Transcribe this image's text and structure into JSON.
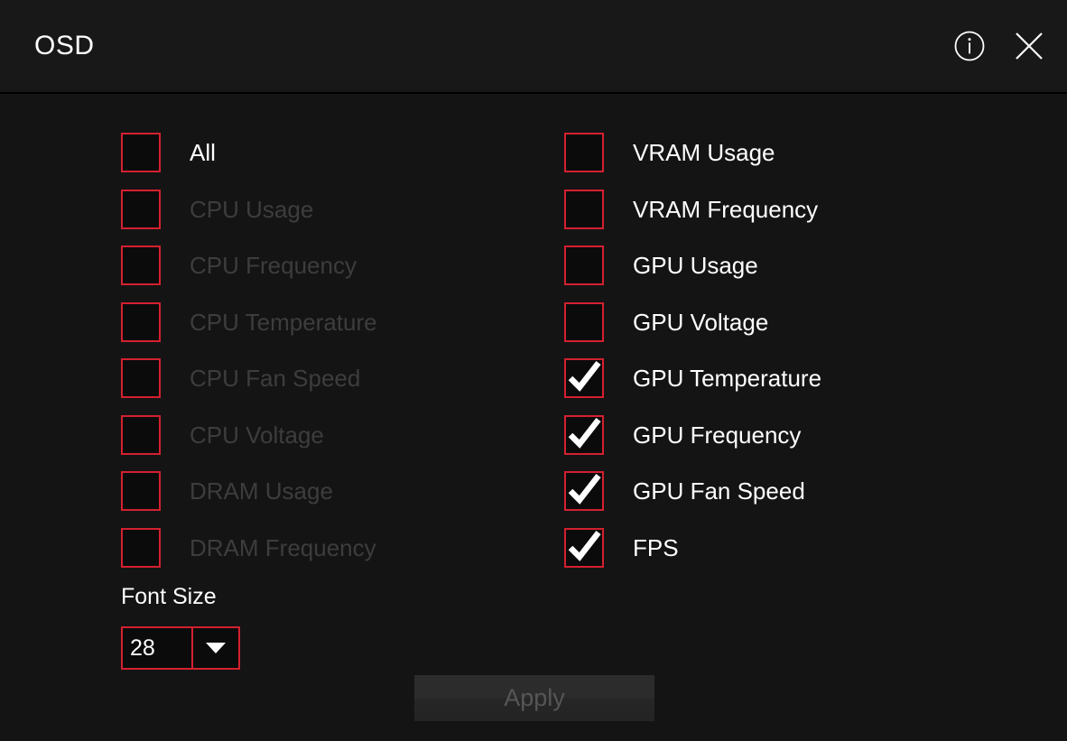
{
  "window": {
    "title": "OSD",
    "accent_color": "#d42030",
    "background_color": "#141414",
    "titlebar_color": "#181818"
  },
  "titlebar": {
    "info_icon": "info-circle-icon",
    "close_icon": "close-icon"
  },
  "options": {
    "left_column": [
      {
        "label": "All",
        "checked": false,
        "enabled": true
      },
      {
        "label": "CPU Usage",
        "checked": false,
        "enabled": false
      },
      {
        "label": "CPU Frequency",
        "checked": false,
        "enabled": false
      },
      {
        "label": "CPU Temperature",
        "checked": false,
        "enabled": false
      },
      {
        "label": "CPU Fan Speed",
        "checked": false,
        "enabled": false
      },
      {
        "label": "CPU Voltage",
        "checked": false,
        "enabled": false
      },
      {
        "label": "DRAM Usage",
        "checked": false,
        "enabled": false
      },
      {
        "label": "DRAM Frequency",
        "checked": false,
        "enabled": false
      }
    ],
    "right_column": [
      {
        "label": "VRAM Usage",
        "checked": false,
        "enabled": true
      },
      {
        "label": "VRAM Frequency",
        "checked": false,
        "enabled": true
      },
      {
        "label": "GPU Usage",
        "checked": false,
        "enabled": true
      },
      {
        "label": "GPU Voltage",
        "checked": false,
        "enabled": true
      },
      {
        "label": "GPU Temperature",
        "checked": true,
        "enabled": true
      },
      {
        "label": "GPU Frequency",
        "checked": true,
        "enabled": true
      },
      {
        "label": "GPU Fan Speed",
        "checked": true,
        "enabled": true
      },
      {
        "label": "FPS",
        "checked": true,
        "enabled": true
      }
    ]
  },
  "font_size": {
    "label": "Font Size",
    "value": "28",
    "dropdown_icon": "chevron-down-icon"
  },
  "apply": {
    "label": "Apply",
    "enabled": false
  }
}
